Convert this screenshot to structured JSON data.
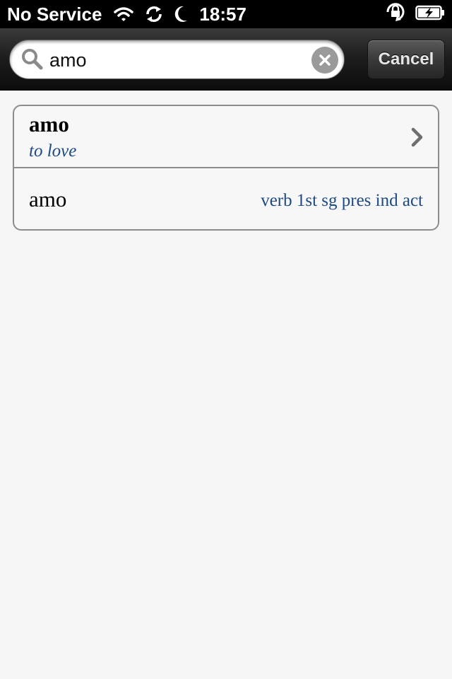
{
  "status_bar": {
    "carrier": "No Service",
    "time": "18:57",
    "icons": [
      "wifi-icon",
      "sync-icon",
      "moon-icon",
      "rotation-lock-icon",
      "battery-charging-icon"
    ]
  },
  "search": {
    "query": "amo",
    "cancel_label": "Cancel"
  },
  "results": [
    {
      "headword": "amo",
      "gloss": "to love"
    },
    {
      "form": "amo",
      "parse": "verb 1st sg pres ind act"
    }
  ],
  "colors": {
    "accent_text": "#1e4a84",
    "background": "#f5f5f5",
    "header_dark": "#1c1c1c"
  }
}
